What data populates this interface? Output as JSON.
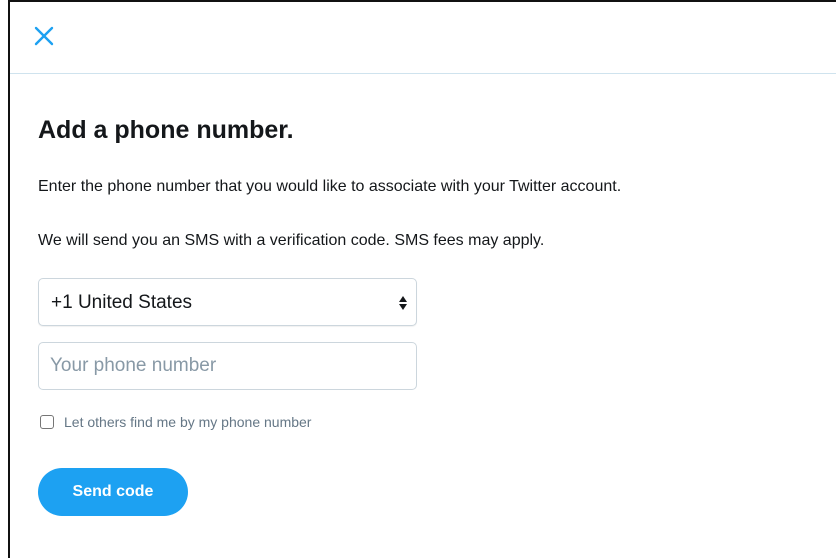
{
  "header": {
    "close_icon": "close-icon",
    "accent_color": "#1da1f2"
  },
  "main": {
    "title": "Add a phone number.",
    "description": "Enter the phone number that you would like to associate with your Twitter account.",
    "sms_notice": "We will send you an SMS with a verification code. SMS fees may apply.",
    "country_select": {
      "selected": "+1 United States"
    },
    "phone_input": {
      "value": "",
      "placeholder": "Your phone number"
    },
    "discoverability": {
      "label": "Let others find me by my phone number",
      "checked": false
    },
    "send_code_label": "Send code"
  }
}
